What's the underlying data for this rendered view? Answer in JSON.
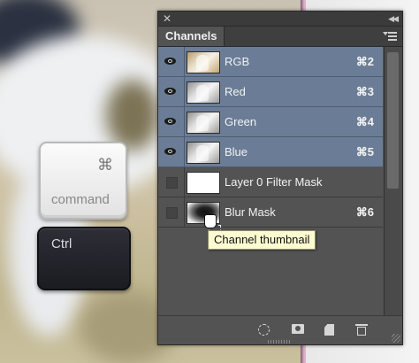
{
  "keyboard": {
    "command_symbol": "⌘",
    "command_label": "command",
    "ctrl_label": "Ctrl"
  },
  "panel": {
    "tab_title": "Channels",
    "channels": [
      {
        "name": "RGB",
        "shortcut": "⌘2",
        "visible": true,
        "selected": true,
        "thumb": "rgb"
      },
      {
        "name": "Red",
        "shortcut": "⌘3",
        "visible": true,
        "selected": true,
        "thumb": "gray"
      },
      {
        "name": "Green",
        "shortcut": "⌘4",
        "visible": true,
        "selected": true,
        "thumb": "gray"
      },
      {
        "name": "Blue",
        "shortcut": "⌘5",
        "visible": true,
        "selected": true,
        "thumb": "gray"
      },
      {
        "name": "Layer 0 Filter Mask",
        "shortcut": "",
        "visible": false,
        "selected": false,
        "thumb": "white"
      },
      {
        "name": "Blur Mask",
        "shortcut": "⌘6",
        "visible": false,
        "selected": false,
        "thumb": "mask"
      }
    ],
    "bottom_icons": [
      "load-selection-icon",
      "save-selection-icon",
      "new-channel-icon",
      "delete-icon"
    ],
    "selection_color": "#6b7d96"
  },
  "tooltip": {
    "text": "Channel thumbnail"
  }
}
